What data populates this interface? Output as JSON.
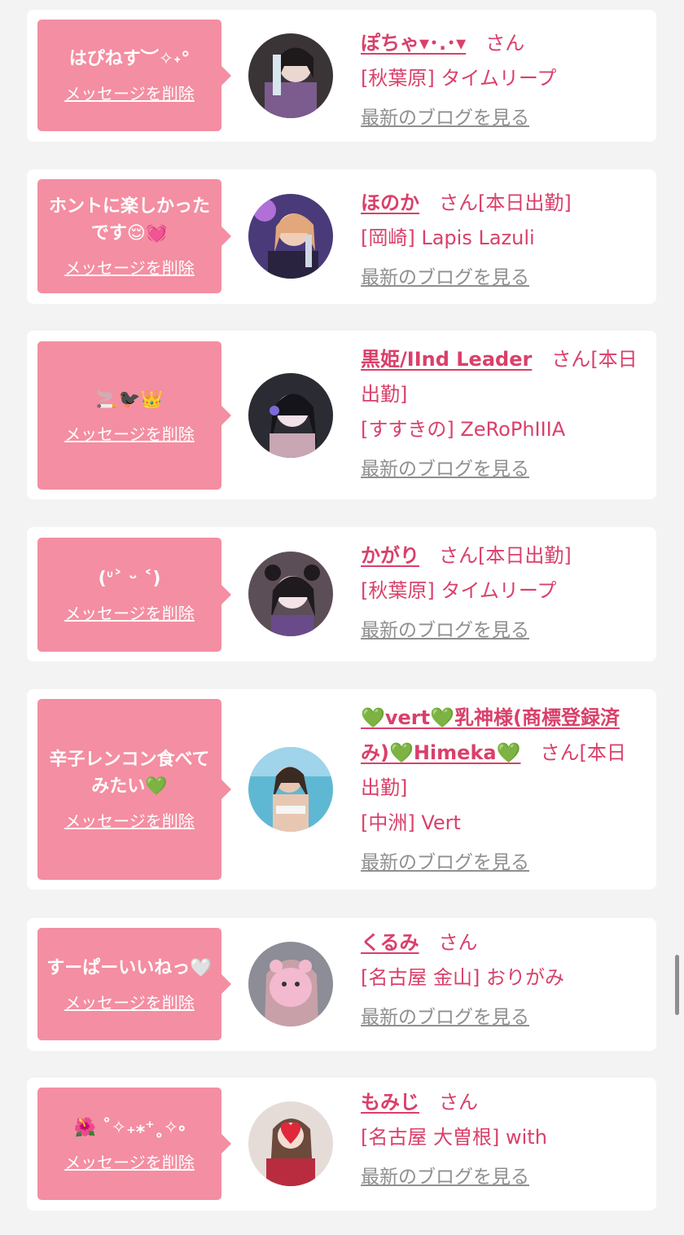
{
  "items": [
    {
      "message": "はぴねす︶✧˖°",
      "delete_label": "メッセージを削除",
      "name": "ぽちゃ▾･.･▾",
      "honorific": "さん",
      "extra": "",
      "shop": "[秋葉原] タイムリープ",
      "blog_label": "最新のブログを見る",
      "avatar_colors": [
        "#3a3436",
        "#7c5b8e"
      ]
    },
    {
      "message": "ホントに楽しかったです😌💓",
      "delete_label": "メッセージを削除",
      "name": "ほのか",
      "honorific": "さん",
      "extra": "[本日出勤]",
      "shop": "[岡崎] Lapis Lazuli",
      "blog_label": "最新のブログを見る",
      "avatar_colors": [
        "#4a3a7a",
        "#e2a77a"
      ]
    },
    {
      "message": "🚬🐦‍⬛👑",
      "delete_label": "メッセージを削除",
      "name": "黒姫/IInd Leader",
      "honorific": "さん",
      "extra": "[本日出勤]",
      "shop": "[すすきの] ZeRoPhIIIA",
      "blog_label": "最新のブログを見る",
      "avatar_colors": [
        "#2b2b33",
        "#c8a6b3"
      ]
    },
    {
      "message": "(ᐡ˃ ᵕ ˂)",
      "delete_label": "メッセージを削除",
      "name": "かがり",
      "honorific": "さん",
      "extra": "[本日出勤]",
      "shop": "[秋葉原] タイムリープ",
      "blog_label": "最新のブログを見る",
      "avatar_colors": [
        "#5c4e57",
        "#d9c7cf"
      ]
    },
    {
      "message": "辛子レンコン食べてみたい💚",
      "delete_label": "メッセージを削除",
      "name": "💚vert💚乳神様(商標登録済み)💚Himeka💚",
      "honorific": "さん",
      "extra": "[本日出勤]",
      "shop": "[中洲] Vert",
      "blog_label": "最新のブログを見る",
      "avatar_colors": [
        "#5fb8d3",
        "#e8c7b2"
      ]
    },
    {
      "message": "すーぱーいいねっ🤍",
      "delete_label": "メッセージを削除",
      "name": "くるみ",
      "honorific": "さん",
      "extra": "",
      "shop": "[名古屋 金山] おりがみ",
      "blog_label": "最新のブログを見る",
      "avatar_colors": [
        "#8c8d96",
        "#f2b9cf"
      ]
    },
    {
      "message": "🌺 ˚✧₊⁎⁺˳✧༚",
      "delete_label": "メッセージを削除",
      "name": "もみじ",
      "honorific": "さん",
      "extra": "",
      "shop": "[名古屋 大曽根] with",
      "blog_label": "最新のブログを見る",
      "avatar_colors": [
        "#e5dcd8",
        "#b92c40"
      ]
    }
  ]
}
